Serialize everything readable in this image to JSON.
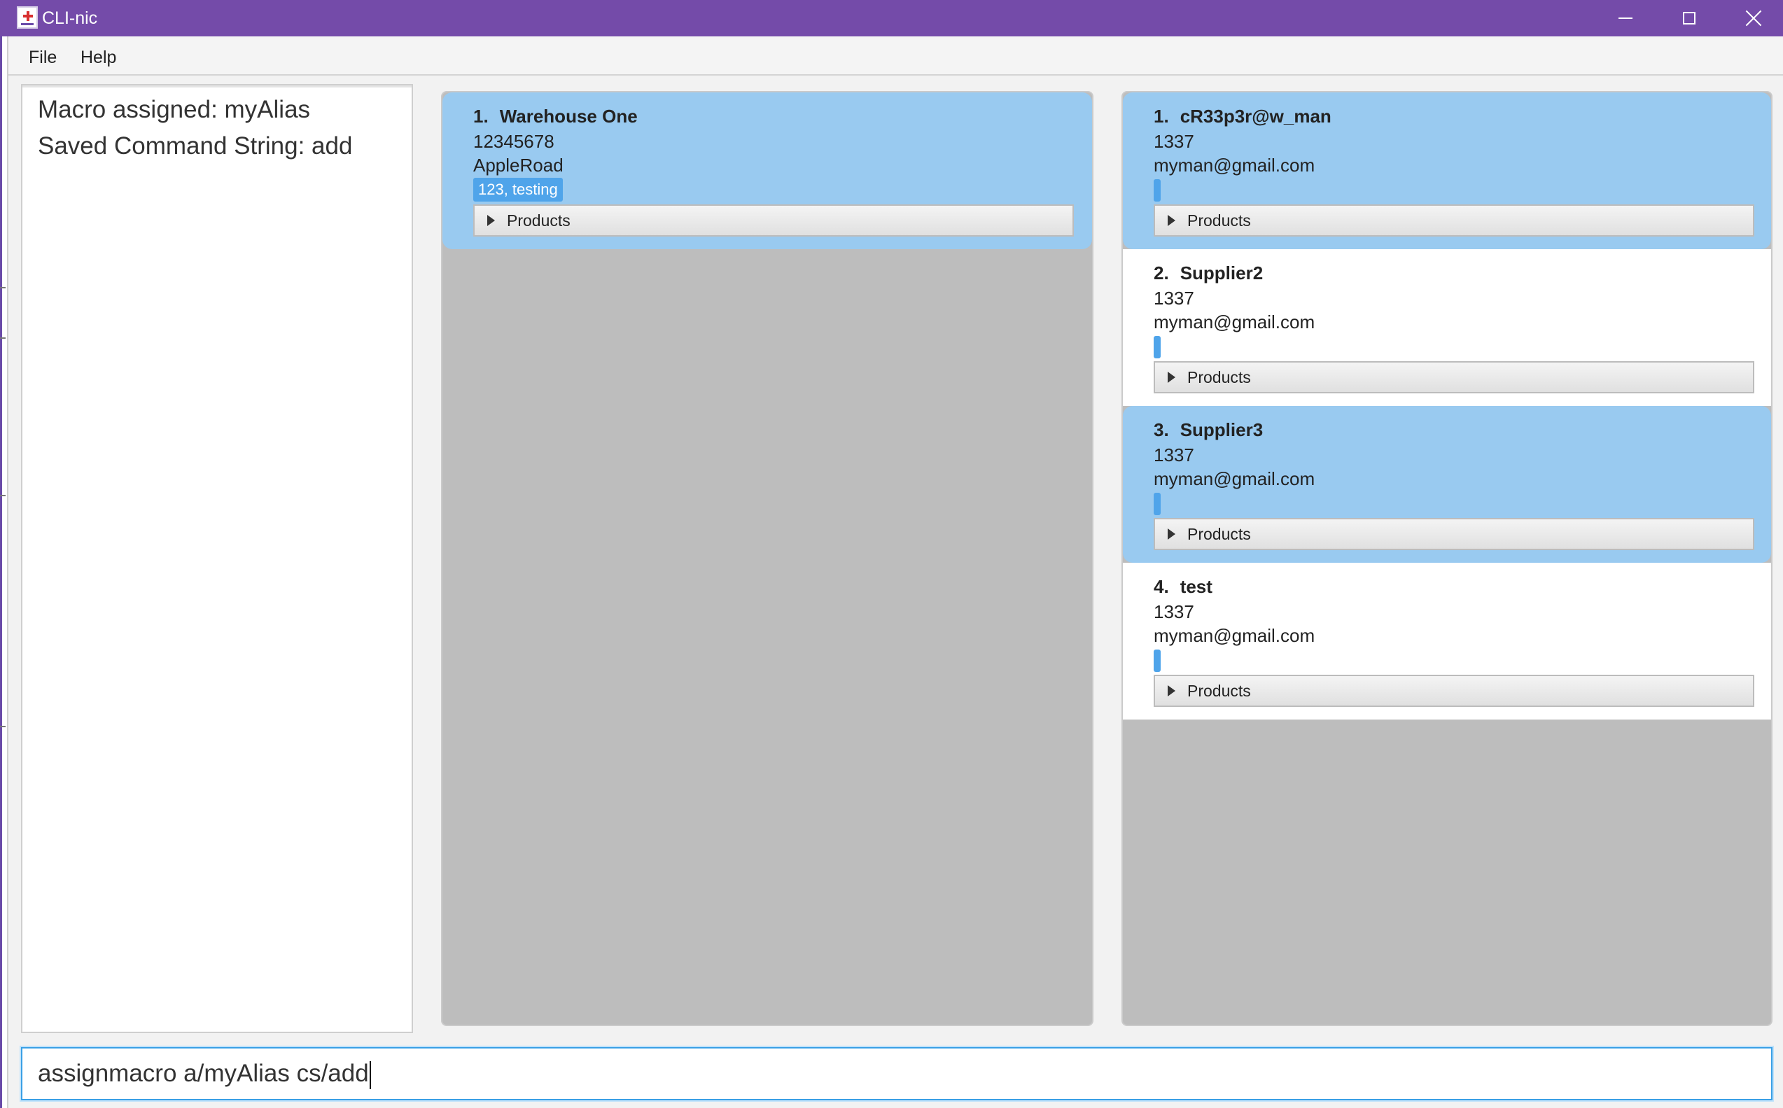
{
  "window": {
    "title": "CLI-nic",
    "controls": [
      "minimize-icon",
      "maximize-icon",
      "close-icon"
    ],
    "accent_color": "#744ba9"
  },
  "menu": {
    "file": "File",
    "help": "Help"
  },
  "result": {
    "line1": "Macro assigned: myAlias",
    "line2": "Saved Command String: add"
  },
  "warehouses": [
    {
      "index": "1.",
      "name": "Warehouse One",
      "phone": "12345678",
      "address": "AppleRoad",
      "tag": "123, testing",
      "products_label": "Products",
      "selected": true
    }
  ],
  "suppliers": [
    {
      "index": "1.",
      "name": "cR33p3r@w_man",
      "phone": "1337",
      "email": "myman@gmail.com",
      "products_label": "Products",
      "selected": true
    },
    {
      "index": "2.",
      "name": "Supplier2",
      "phone": "1337",
      "email": "myman@gmail.com",
      "products_label": "Products",
      "selected": false
    },
    {
      "index": "3.",
      "name": "Supplier3",
      "phone": "1337",
      "email": "myman@gmail.com",
      "products_label": "Products",
      "selected": true
    },
    {
      "index": "4.",
      "name": "test",
      "phone": "1337",
      "email": "myman@gmail.com",
      "products_label": "Products",
      "selected": false
    }
  ],
  "command": {
    "value": "assignmacro a/myAlias cs/add"
  },
  "colors": {
    "selected_card": "#99caf0",
    "tag": "#4fa4ea",
    "empty_list": "#bdbdbd",
    "focus_border": "#3aa0e6"
  }
}
